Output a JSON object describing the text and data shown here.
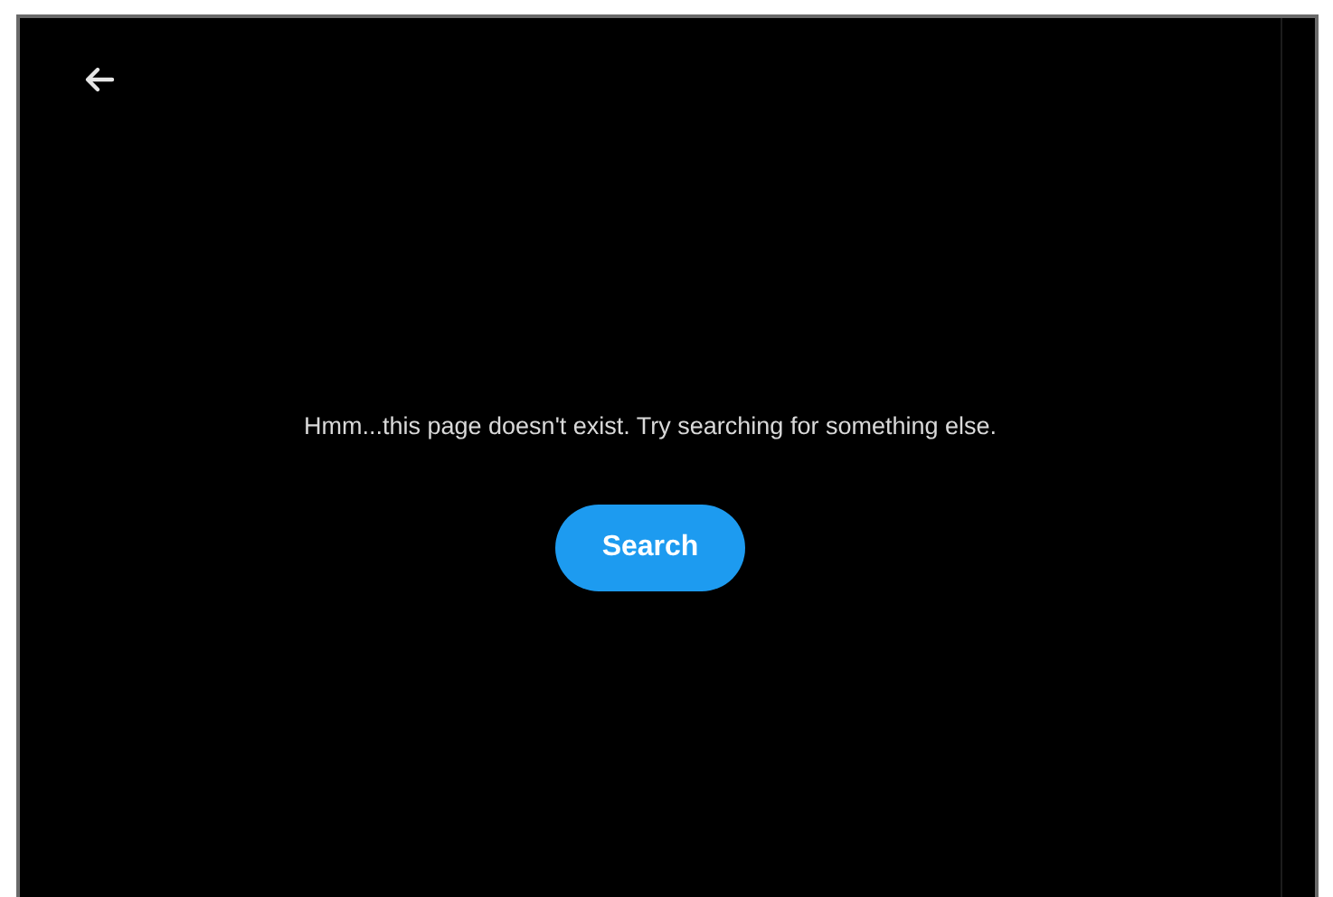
{
  "message": "Hmm...this page doesn't exist. Try searching for something else.",
  "button": {
    "label": "Search"
  }
}
